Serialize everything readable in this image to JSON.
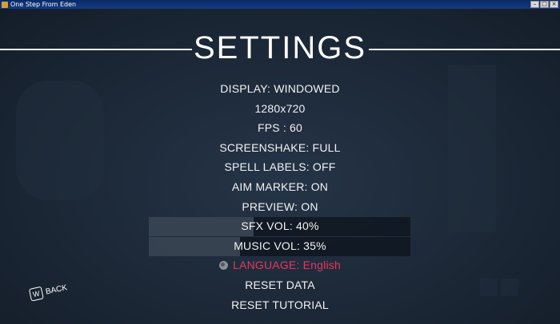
{
  "window": {
    "title": "One Step From Eden"
  },
  "settings": {
    "title": "SETTINGS",
    "items": [
      {
        "label": "DISPLAY: WINDOWED"
      },
      {
        "label": "1280x720"
      },
      {
        "label": "FPS : 60"
      },
      {
        "label": "SCREENSHAKE: FULL"
      },
      {
        "label": "SPELL LABELS: OFF"
      },
      {
        "label": "AIM MARKER: ON"
      },
      {
        "label": "PREVIEW: ON"
      },
      {
        "label": "SFX VOL: 40%",
        "level": 0.4
      },
      {
        "label": "MUSIC VOL: 35%",
        "level": 0.35
      },
      {
        "label": "LANGUAGE: English",
        "active": true
      },
      {
        "label": "RESET DATA"
      },
      {
        "label": "RESET TUTORIAL"
      }
    ]
  },
  "back": {
    "key": "W",
    "label": "BACK"
  },
  "colors": {
    "accent": "#e8365f",
    "text": "#f2f2f2",
    "background": "#1c2837"
  }
}
